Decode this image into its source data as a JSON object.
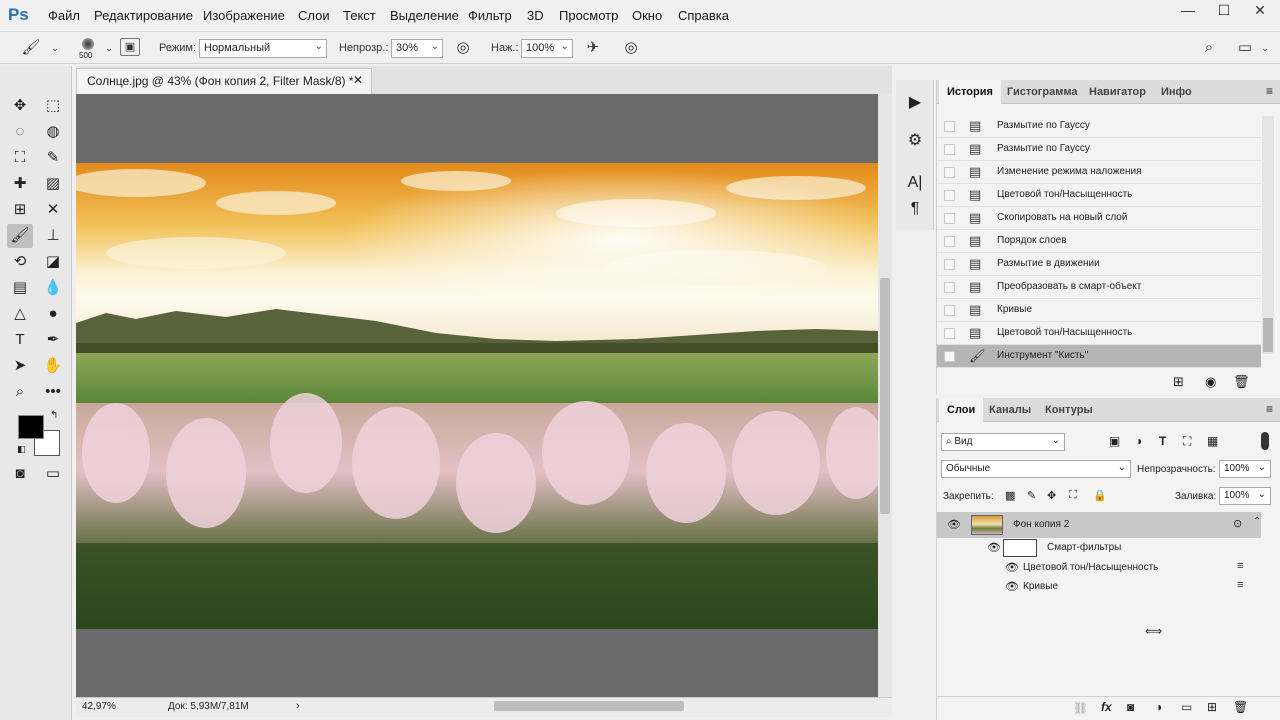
{
  "app": {
    "logo": "Ps"
  },
  "menu": [
    "Файл",
    "Редактирование",
    "Изображение",
    "Слои",
    "Текст",
    "Выделение",
    "Фильтр",
    "3D",
    "Просмотр",
    "Окно",
    "Справка"
  ],
  "window_controls": {
    "minimize": "—",
    "maximize": "☐",
    "close": "✕"
  },
  "options": {
    "brush_size": "500",
    "mode_label": "Режим:",
    "mode_value": "Нормальный",
    "opacity_label": "Непрозр.:",
    "opacity_value": "30%",
    "flow_label": "Наж.:",
    "flow_value": "100%"
  },
  "document": {
    "tab_title": "Солнце.jpg @ 43% (Фон копия 2, Filter Mask/8) *",
    "zoom": "42,97%",
    "doc_info": "Док: 5,93M/7,81M"
  },
  "history_panel": {
    "tabs": [
      "История",
      "Гистограмма",
      "Навигатор",
      "Инфо"
    ],
    "active_tab": "История",
    "items": [
      "Размытие по Гауссу",
      "Размытие по Гауссу",
      "Изменение режима наложения",
      "Цветовой тон/Насыщенность",
      "Скопировать на новый слой",
      "Порядок слоев",
      "Размытие в движении",
      "Преобразовать в смарт-объект",
      "Кривые",
      "Цветовой тон/Насыщенность",
      "Инструмент \"Кисть\""
    ]
  },
  "layers_panel": {
    "tabs": [
      "Слои",
      "Каналы",
      "Контуры"
    ],
    "active_tab": "Слои",
    "filter_kind": "Вид",
    "blend_mode": "Обычные",
    "opacity_label": "Непрозрачность:",
    "opacity_value": "100%",
    "lock_label": "Закрепить:",
    "fill_label": "Заливка:",
    "fill_value": "100%",
    "layer_name": "Фон копия 2",
    "smart_filters_label": "Смарт-фильтры",
    "filters": [
      "Цветовой тон/Насыщенность",
      "Кривые"
    ]
  },
  "colors": {
    "foreground": "#000000",
    "background": "#ffffff",
    "ps_blue": "#2c6fb8",
    "selected_row": "#b5b5b5"
  }
}
